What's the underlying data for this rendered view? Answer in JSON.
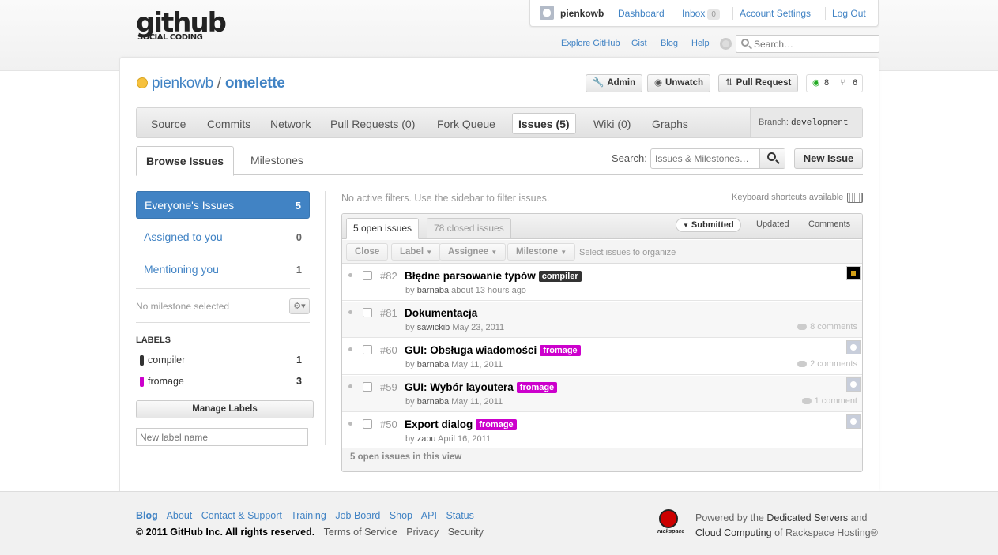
{
  "header": {
    "logo_main": "github",
    "logo_sub": "SOCIAL CODING",
    "username": "pienkowb",
    "links": [
      "Dashboard",
      "Inbox",
      "Account Settings",
      "Log Out"
    ],
    "inbox_count": "0",
    "subnav": [
      "Explore GitHub",
      "Gist",
      "Blog",
      "Help"
    ],
    "search_placeholder": "Search…"
  },
  "repo": {
    "owner": "pienkowb",
    "slash": "/",
    "name": "omelette",
    "buttons": {
      "admin": "Admin",
      "unwatch": "Unwatch",
      "pull_request": "Pull Request"
    },
    "watchers": "8",
    "forks": "6"
  },
  "tabs": [
    {
      "label": "Source"
    },
    {
      "label": "Commits"
    },
    {
      "label": "Network"
    },
    {
      "label": "Pull Requests (0)"
    },
    {
      "label": "Fork Queue"
    },
    {
      "label": "Issues (5)"
    },
    {
      "label": "Wiki (0)"
    },
    {
      "label": "Graphs"
    }
  ],
  "branch": {
    "label": "Branch:",
    "value": "development"
  },
  "subtabs": [
    "Browse Issues",
    "Milestones"
  ],
  "issue_search": {
    "label": "Search:",
    "placeholder": "Issues & Milestones…"
  },
  "new_issue": "New Issue",
  "sidebar": {
    "filters": [
      {
        "label": "Everyone's Issues",
        "count": "5"
      },
      {
        "label": "Assigned to you",
        "count": "0"
      },
      {
        "label": "Mentioning you",
        "count": "1"
      }
    ],
    "milestone": "No milestone selected",
    "labels_heading": "LABELS",
    "labels": [
      {
        "name": "compiler",
        "count": "1",
        "color": "#333333"
      },
      {
        "name": "fromage",
        "count": "3",
        "color": "#cc00cc"
      }
    ],
    "manage_labels": "Manage Labels",
    "new_label_placeholder": "New label name"
  },
  "issues_panel": {
    "no_filters": "No active filters. Use the sidebar to filter issues.",
    "keyboard_hint": "Keyboard shortcuts available",
    "open_tab": "5 open issues",
    "closed_tab": "78 closed issues",
    "sort": [
      "Submitted",
      "Updated",
      "Comments"
    ],
    "toolbar": [
      "Close",
      "Label",
      "Assignee",
      "Milestone"
    ],
    "toolbar_hint": "Select issues to organize",
    "footer": "5 open issues in this view",
    "issues": [
      {
        "number": "#82",
        "title": "Błędne parsowanie typów",
        "label": "compiler",
        "label_color": "#333333",
        "author": "barnaba",
        "when": "about 13 hours ago",
        "comments": ""
      },
      {
        "number": "#81",
        "title": "Dokumentacja",
        "label": "",
        "label_color": "",
        "author": "sawickib",
        "when": "May 23, 2011",
        "comments": "8 comments"
      },
      {
        "number": "#60",
        "title": "GUI: Obsługa wiadomości",
        "label": "fromage",
        "label_color": "#cc00cc",
        "author": "barnaba",
        "when": "May 11, 2011",
        "comments": "2 comments"
      },
      {
        "number": "#59",
        "title": "GUI: Wybór layoutera",
        "label": "fromage",
        "label_color": "#cc00cc",
        "author": "barnaba",
        "when": "May 11, 2011",
        "comments": "1 comment"
      },
      {
        "number": "#50",
        "title": "Export dialog",
        "label": "fromage",
        "label_color": "#cc00cc",
        "author": "zapu",
        "when": "April 16, 2011",
        "comments": ""
      }
    ]
  },
  "footer": {
    "links": [
      "Blog",
      "About",
      "Contact & Support",
      "Training",
      "Job Board",
      "Shop",
      "API",
      "Status"
    ],
    "copyright": "© 2011 GitHub Inc. All rights reserved.",
    "legal": [
      "Terms of Service",
      "Privacy",
      "Security"
    ],
    "rackspace_logo": "rackspace",
    "powered_1a": "Powered by the",
    "powered_1b": "Dedicated Servers",
    "powered_1c": "and",
    "powered_2a": "Cloud Computing",
    "powered_2b": "of Rackspace Hosting®"
  }
}
